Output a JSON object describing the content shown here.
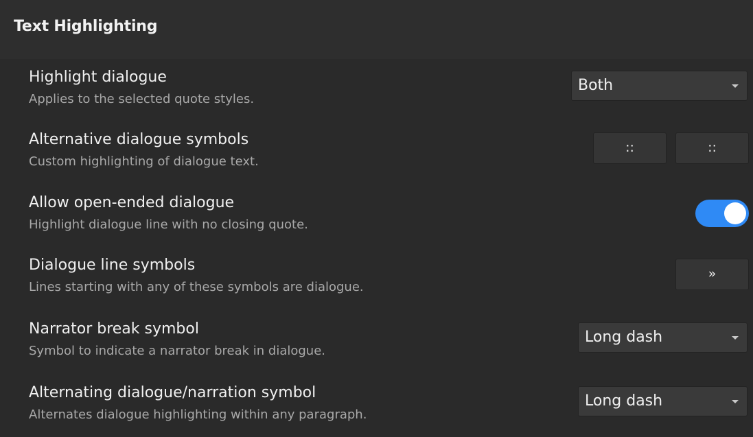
{
  "section": {
    "title": "Text Highlighting"
  },
  "settings": [
    {
      "title": "Highlight dialogue",
      "description": "Applies to the selected quote styles.",
      "control": "select",
      "value": "Both"
    },
    {
      "title": "Alternative dialogue symbols",
      "description": "Custom highlighting of dialogue text.",
      "control": "buttons",
      "buttons": [
        "::",
        "::"
      ]
    },
    {
      "title": "Allow open-ended dialogue",
      "description": "Highlight dialogue line with no closing quote.",
      "control": "toggle",
      "value": true
    },
    {
      "title": "Dialogue line symbols",
      "description": "Lines starting with any of these symbols are dialogue.",
      "control": "button",
      "buttons": [
        "»"
      ]
    },
    {
      "title": "Narrator break symbol",
      "description": "Symbol to indicate a narrator break in dialogue.",
      "control": "select",
      "value": "Long dash"
    },
    {
      "title": "Alternating dialogue/narration symbol",
      "description": "Alternates dialogue highlighting within any paragraph.",
      "control": "select",
      "value": "Long dash"
    }
  ],
  "colors": {
    "background": "#2a2a2a",
    "toggle_on": "#2f8af5",
    "title_text": "#f0f0f0",
    "description_text": "#a9a9a9"
  }
}
